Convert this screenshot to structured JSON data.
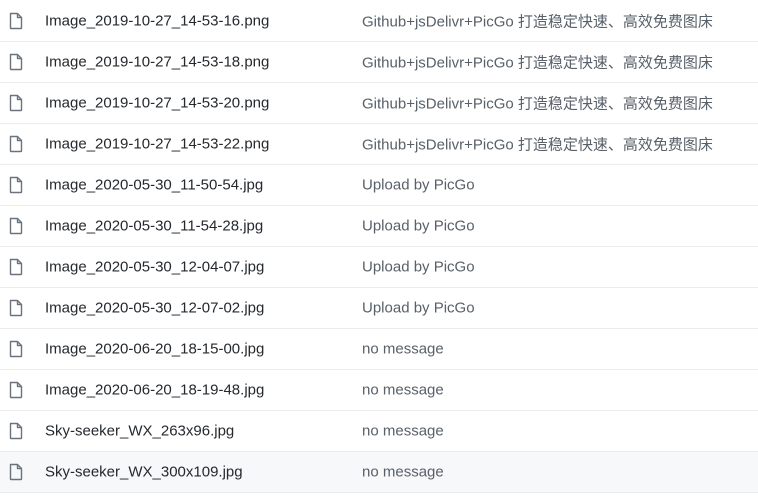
{
  "files": [
    {
      "name": "Image_2019-10-27_14-53-16.png",
      "message": "Github+jsDelivr+PicGo 打造稳定快速、高效免费图床",
      "icon": "file-icon"
    },
    {
      "name": "Image_2019-10-27_14-53-18.png",
      "message": "Github+jsDelivr+PicGo 打造稳定快速、高效免费图床",
      "icon": "file-icon"
    },
    {
      "name": "Image_2019-10-27_14-53-20.png",
      "message": "Github+jsDelivr+PicGo 打造稳定快速、高效免费图床",
      "icon": "file-icon"
    },
    {
      "name": "Image_2019-10-27_14-53-22.png",
      "message": "Github+jsDelivr+PicGo 打造稳定快速、高效免费图床",
      "icon": "file-icon"
    },
    {
      "name": "Image_2020-05-30_11-50-54.jpg",
      "message": "Upload by PicGo",
      "icon": "file-icon"
    },
    {
      "name": "Image_2020-05-30_11-54-28.jpg",
      "message": "Upload by PicGo",
      "icon": "file-icon"
    },
    {
      "name": "Image_2020-05-30_12-04-07.jpg",
      "message": "Upload by PicGo",
      "icon": "file-icon"
    },
    {
      "name": "Image_2020-05-30_12-07-02.jpg",
      "message": "Upload by PicGo",
      "icon": "file-icon"
    },
    {
      "name": "Image_2020-06-20_18-15-00.jpg",
      "message": "no message",
      "icon": "file-icon"
    },
    {
      "name": "Image_2020-06-20_18-19-48.jpg",
      "message": "no message",
      "icon": "file-icon"
    },
    {
      "name": "Sky-seeker_WX_263x96.jpg",
      "message": "no message",
      "icon": "file-icon"
    },
    {
      "name": "Sky-seeker_WX_300x109.jpg",
      "message": "no message",
      "icon": "file-icon"
    }
  ],
  "colors": {
    "icon": "#6a737d",
    "name_text": "#24292e",
    "message_text": "#586069",
    "row_border": "#eaecef",
    "hover_row": "#f6f8fa"
  }
}
